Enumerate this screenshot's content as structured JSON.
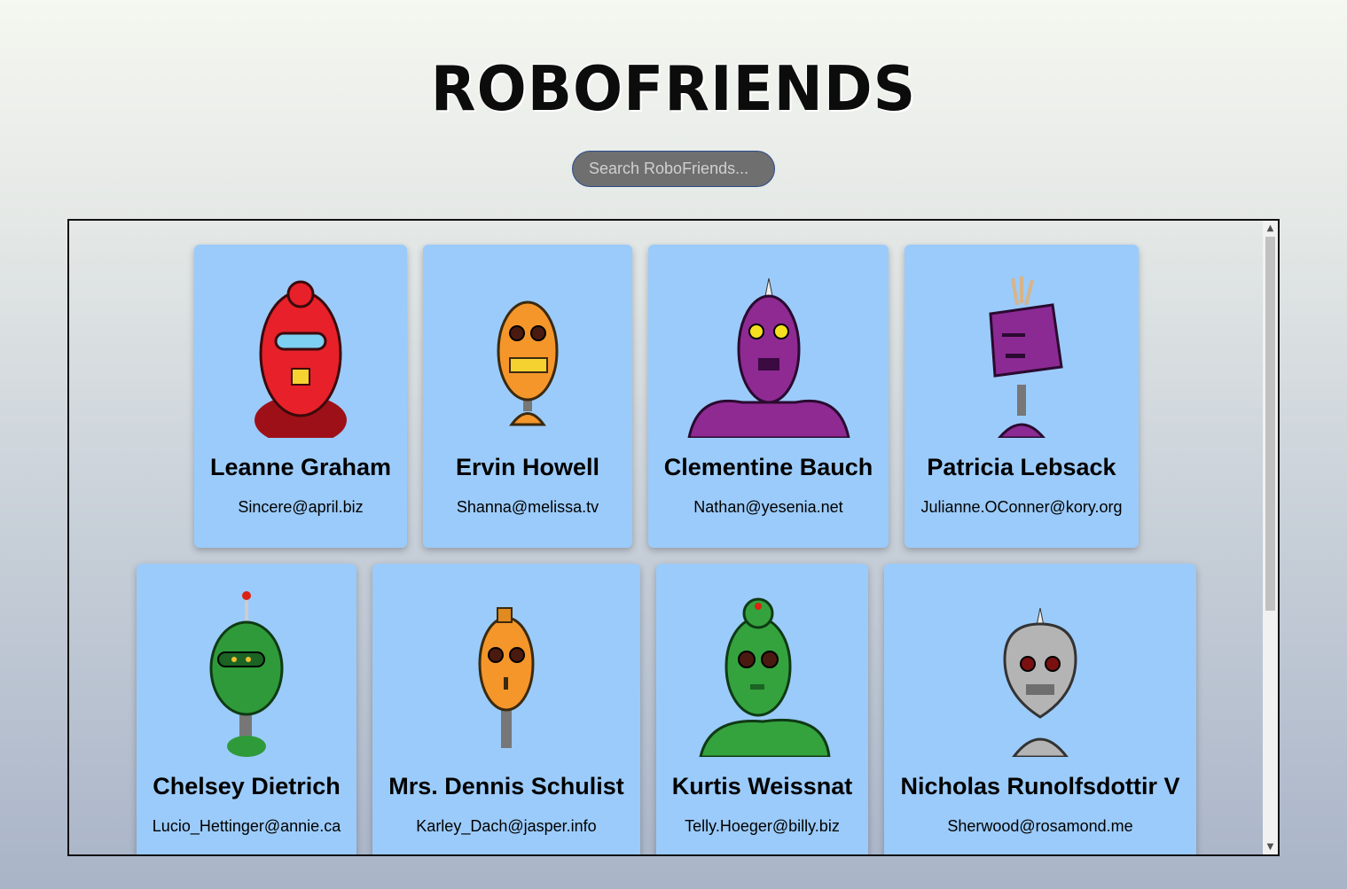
{
  "app": {
    "title": "RoboFriends",
    "search_placeholder": "Search RoboFriends..."
  },
  "robots": [
    {
      "name": "Leanne Graham",
      "email": "Sincere@april.biz",
      "color": "#e8202a",
      "dark": "#9e1018",
      "avatar": "red-robot-icon"
    },
    {
      "name": "Ervin Howell",
      "email": "Shanna@melissa.tv",
      "color": "#f5962a",
      "dark": "#b8621a",
      "avatar": "orange-robot-icon"
    },
    {
      "name": "Clementine Bauch",
      "email": "Nathan@yesenia.net",
      "color": "#8e2a92",
      "dark": "#5a1460",
      "avatar": "purple-robot-icon"
    },
    {
      "name": "Patricia Lebsack",
      "email": "Julianne.OConner@kory.org",
      "color": "#8c2a94",
      "dark": "#5a1460",
      "avatar": "purple-robot-icon"
    },
    {
      "name": "Chelsey Dietrich",
      "email": "Lucio_Hettinger@annie.ca",
      "color": "#2f9a3a",
      "dark": "#1b6423",
      "avatar": "green-robot-icon"
    },
    {
      "name": "Mrs. Dennis Schulist",
      "email": "Karley_Dach@jasper.info",
      "color": "#f5962a",
      "dark": "#b8621a",
      "avatar": "orange-robot-icon"
    },
    {
      "name": "Kurtis Weissnat",
      "email": "Telly.Hoeger@billy.biz",
      "color": "#34a33e",
      "dark": "#1b6423",
      "avatar": "green-robot-icon"
    },
    {
      "name": "Nicholas Runolfsdottir V",
      "email": "Sherwood@rosamond.me",
      "color": "#b4b4b4",
      "dark": "#6e6e6e",
      "avatar": "gray-robot-icon"
    }
  ]
}
